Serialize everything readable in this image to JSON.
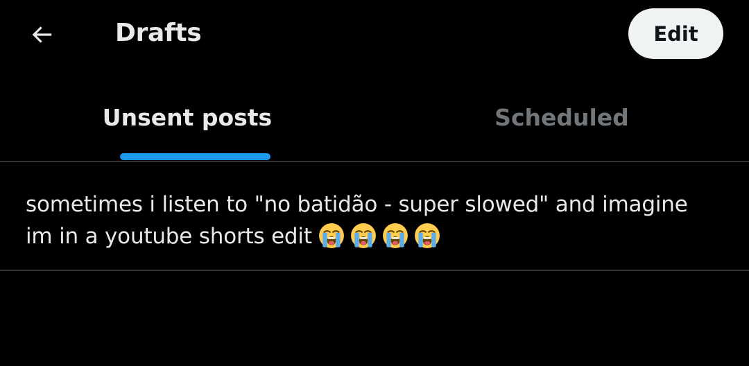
{
  "header": {
    "title": "Drafts",
    "back_icon": "arrow-left-icon",
    "edit_label": "Edit"
  },
  "tabs": [
    {
      "label": "Unsent posts",
      "active": true
    },
    {
      "label": "Scheduled",
      "active": false
    }
  ],
  "drafts": [
    {
      "text": "sometimes i listen to \"no batidão - super slowed\" and imagine im in a youtube shorts edit",
      "emojis": [
        "loudly-crying-face-icon",
        "loudly-crying-face-icon",
        "loudly-crying-face-icon",
        "loudly-crying-face-icon"
      ]
    }
  ],
  "colors": {
    "background": "#000000",
    "text_primary": "#e7e9ea",
    "text_secondary": "#71767b",
    "accent": "#1d9bf0",
    "divider": "#2f3336",
    "button_bg": "#eff3f4"
  }
}
